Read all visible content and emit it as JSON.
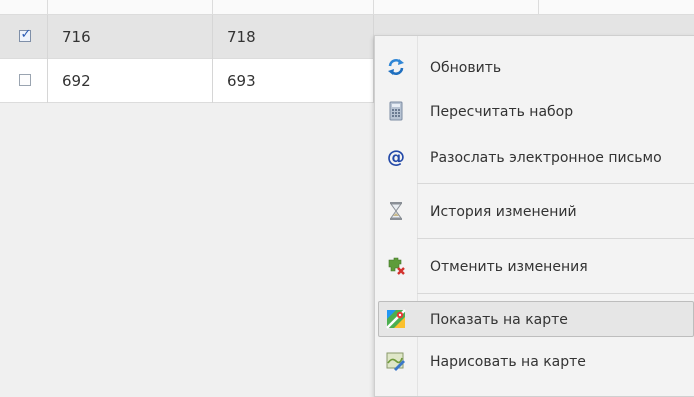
{
  "grid": {
    "rows": [
      {
        "checked": true,
        "col_a": "716",
        "col_b": "718"
      },
      {
        "checked": false,
        "col_a": "692",
        "col_b": "693"
      }
    ]
  },
  "context_menu": {
    "items": [
      {
        "label": "Обновить",
        "icon": "refresh-icon"
      },
      {
        "label": "Пересчитать набор",
        "icon": "calculator-icon"
      },
      {
        "label": "Разослать электронное письмо",
        "icon": "email-at-icon"
      },
      {
        "label": "История изменений",
        "icon": "hourglass-icon"
      },
      {
        "label": "Отменить изменения",
        "icon": "undo-changes-icon"
      },
      {
        "label": "Показать на карте",
        "icon": "map-icon",
        "highlighted": true
      },
      {
        "label": "Нарисовать на карте",
        "icon": "draw-on-map-icon"
      }
    ]
  },
  "colors": {
    "selected_row": "#e4e4e4",
    "menu_background": "#f3f3f3",
    "menu_highlight": "#e6e6e6"
  }
}
